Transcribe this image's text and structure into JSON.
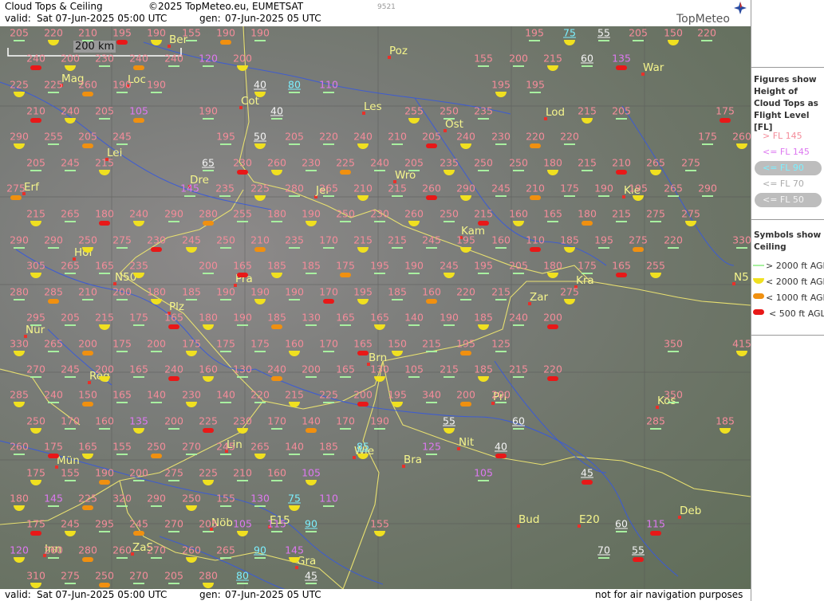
{
  "header": {
    "title": "Cloud Tops & Ceiling",
    "copyright": "©2025 TopMeteo.eu, EUMETSAT",
    "code": "9521",
    "valid_label": "valid:",
    "valid_time": "Sat  07-Jun-2025  05:00 UTC",
    "gen_label": "gen:",
    "gen_time": "07-Jun-2025 05 UTC",
    "brand": "TopMeteo"
  },
  "scale": {
    "label": "200 km"
  },
  "footer": {
    "valid_label": "valid:",
    "valid_time": "Sat  07-Jun-2025  05:00 UTC",
    "gen_label": "gen:",
    "gen_time": "07-Jun-2025 05 UTC",
    "disclaimer": "not for air navigation purposes"
  },
  "legend": {
    "figures_title": "Figures show Height of Cloud Tops as Flight Level  [FL]",
    "fl_items": [
      "> FL 145",
      "<= FL 145",
      "<= FL 90",
      "<= FL 70",
      "<= FL 50"
    ],
    "symbols_title": "Symbols show Ceiling",
    "ceiling_items": [
      "> 2000 ft AGL",
      "< 2000 ft AGL",
      "< 1000 ft AGL",
      "< 500 ft AGL"
    ],
    "colors": {
      "pink": "#f48c9a",
      "violet": "#dd78f0",
      "cyan": "#7cf0ff",
      "white": "#f4f4f4",
      "green": "#a8f0a0",
      "yellow": "#f0e020",
      "orange": "#f09010",
      "red": "#e81818"
    }
  },
  "cities": [
    {
      "name": "Ber"
    },
    {
      "name": "Poz"
    },
    {
      "name": "War"
    },
    {
      "name": "Mag"
    },
    {
      "name": "Loc"
    },
    {
      "name": "Cot"
    },
    {
      "name": "Les"
    },
    {
      "name": "Ost"
    },
    {
      "name": "Lod"
    },
    {
      "name": "Lei"
    },
    {
      "name": "Dre"
    },
    {
      "name": "Wro"
    },
    {
      "name": "Erf"
    },
    {
      "name": "Jel"
    },
    {
      "name": "Kie"
    },
    {
      "name": "Kam"
    },
    {
      "name": "Hof"
    },
    {
      "name": "N50"
    },
    {
      "name": "Pra"
    },
    {
      "name": "Kra"
    },
    {
      "name": "N5"
    },
    {
      "name": "Plz"
    },
    {
      "name": "Zar"
    },
    {
      "name": "Nür"
    },
    {
      "name": "Brn"
    },
    {
      "name": "Reg"
    },
    {
      "name": "Pri"
    },
    {
      "name": "Kos"
    },
    {
      "name": "Nit"
    },
    {
      "name": "Lin"
    },
    {
      "name": "Wie"
    },
    {
      "name": "Bra"
    },
    {
      "name": "Mün"
    },
    {
      "name": "Bud"
    },
    {
      "name": "E20"
    },
    {
      "name": "Deb"
    },
    {
      "name": "Nöb"
    },
    {
      "name": "E15"
    },
    {
      "name": "Inn"
    },
    {
      "name": "ZaS"
    },
    {
      "name": "Gra"
    }
  ],
  "values": [
    [
      "205",
      "p"
    ],
    [
      "220",
      "p"
    ],
    [
      "210",
      "p"
    ],
    [
      "195",
      "p"
    ],
    [
      "190",
      "p"
    ],
    [
      "155",
      "p"
    ],
    [
      "190",
      "p"
    ],
    [
      "190",
      "p"
    ],
    [
      "195",
      "p"
    ],
    [
      "75",
      "c"
    ],
    [
      "55",
      "w"
    ],
    [
      "205",
      "p"
    ],
    [
      "150",
      "p"
    ],
    [
      "220",
      "p"
    ],
    [
      "240",
      "p"
    ],
    [
      "200",
      "p"
    ],
    [
      "230",
      "p"
    ],
    [
      "240",
      "p"
    ],
    [
      "240",
      "p"
    ],
    [
      "120",
      "v"
    ],
    [
      "200",
      "p"
    ],
    [
      "155",
      "p"
    ],
    [
      "200",
      "p"
    ],
    [
      "215",
      "p"
    ],
    [
      "60",
      "w"
    ],
    [
      "135",
      "v"
    ],
    [
      "225",
      "p"
    ],
    [
      "225",
      "p"
    ],
    [
      "260",
      "p"
    ],
    [
      "190",
      "p"
    ],
    [
      "190",
      "p"
    ],
    [
      "40",
      "w"
    ],
    [
      "80",
      "c"
    ],
    [
      "110",
      "v"
    ],
    [
      "195",
      "p"
    ],
    [
      "195",
      "p"
    ],
    [
      "210",
      "p"
    ],
    [
      "240",
      "p"
    ],
    [
      "205",
      "p"
    ],
    [
      "105",
      "v"
    ],
    [
      "190",
      "p"
    ],
    [
      "40",
      "w"
    ],
    [
      "255",
      "p"
    ],
    [
      "250",
      "p"
    ],
    [
      "235",
      "p"
    ],
    [
      "215",
      "p"
    ],
    [
      "205",
      "p"
    ],
    [
      "175",
      "p"
    ],
    [
      "290",
      "p"
    ],
    [
      "255",
      "p"
    ],
    [
      "205",
      "p"
    ],
    [
      "245",
      "p"
    ],
    [
      "195",
      "p"
    ],
    [
      "50",
      "w"
    ],
    [
      "205",
      "p"
    ],
    [
      "220",
      "p"
    ],
    [
      "240",
      "p"
    ],
    [
      "210",
      "p"
    ],
    [
      "205",
      "p"
    ],
    [
      "240",
      "p"
    ],
    [
      "230",
      "p"
    ],
    [
      "220",
      "p"
    ],
    [
      "220",
      "p"
    ],
    [
      "175",
      "p"
    ],
    [
      "260",
      "p"
    ],
    [
      "205",
      "p"
    ],
    [
      "245",
      "p"
    ],
    [
      "215",
      "p"
    ],
    [
      "65",
      "w"
    ],
    [
      "230",
      "p"
    ],
    [
      "260",
      "p"
    ],
    [
      "230",
      "p"
    ],
    [
      "225",
      "p"
    ],
    [
      "240",
      "p"
    ],
    [
      "205",
      "p"
    ],
    [
      "235",
      "p"
    ],
    [
      "250",
      "p"
    ],
    [
      "250",
      "p"
    ],
    [
      "180",
      "p"
    ],
    [
      "215",
      "p"
    ],
    [
      "210",
      "p"
    ],
    [
      "265",
      "p"
    ],
    [
      "275",
      "p"
    ],
    [
      "275",
      "p"
    ],
    [
      "145",
      "v"
    ],
    [
      "235",
      "p"
    ],
    [
      "225",
      "p"
    ],
    [
      "280",
      "p"
    ],
    [
      "265",
      "p"
    ],
    [
      "210",
      "p"
    ],
    [
      "215",
      "p"
    ],
    [
      "260",
      "p"
    ],
    [
      "290",
      "p"
    ],
    [
      "245",
      "p"
    ],
    [
      "210",
      "p"
    ],
    [
      "175",
      "p"
    ],
    [
      "190",
      "p"
    ],
    [
      "195",
      "p"
    ],
    [
      "265",
      "p"
    ],
    [
      "290",
      "p"
    ],
    [
      "215",
      "p"
    ],
    [
      "265",
      "p"
    ],
    [
      "180",
      "p"
    ],
    [
      "240",
      "p"
    ],
    [
      "290",
      "p"
    ],
    [
      "280",
      "p"
    ],
    [
      "255",
      "p"
    ],
    [
      "180",
      "p"
    ],
    [
      "190",
      "p"
    ],
    [
      "250",
      "p"
    ],
    [
      "230",
      "p"
    ],
    [
      "260",
      "p"
    ],
    [
      "250",
      "p"
    ],
    [
      "215",
      "p"
    ],
    [
      "160",
      "p"
    ],
    [
      "165",
      "p"
    ],
    [
      "180",
      "p"
    ],
    [
      "215",
      "p"
    ],
    [
      "275",
      "p"
    ],
    [
      "275",
      "p"
    ],
    [
      "290",
      "p"
    ],
    [
      "290",
      "p"
    ],
    [
      "250",
      "p"
    ],
    [
      "275",
      "p"
    ],
    [
      "230",
      "p"
    ],
    [
      "245",
      "p"
    ],
    [
      "250",
      "p"
    ],
    [
      "210",
      "p"
    ],
    [
      "235",
      "p"
    ],
    [
      "170",
      "p"
    ],
    [
      "215",
      "p"
    ],
    [
      "215",
      "p"
    ],
    [
      "245",
      "p"
    ],
    [
      "195",
      "p"
    ],
    [
      "160",
      "p"
    ],
    [
      "110",
      "p"
    ],
    [
      "185",
      "p"
    ],
    [
      "195",
      "p"
    ],
    [
      "275",
      "p"
    ],
    [
      "220",
      "p"
    ],
    [
      "330",
      "p"
    ],
    [
      "305",
      "p"
    ],
    [
      "265",
      "p"
    ],
    [
      "165",
      "p"
    ],
    [
      "235",
      "p"
    ],
    [
      "200",
      "p"
    ],
    [
      "165",
      "p"
    ],
    [
      "185",
      "p"
    ],
    [
      "185",
      "p"
    ],
    [
      "175",
      "p"
    ],
    [
      "195",
      "p"
    ],
    [
      "190",
      "p"
    ],
    [
      "245",
      "p"
    ],
    [
      "195",
      "p"
    ],
    [
      "205",
      "p"
    ],
    [
      "180",
      "p"
    ],
    [
      "175",
      "p"
    ],
    [
      "165",
      "p"
    ],
    [
      "255",
      "p"
    ],
    [
      "280",
      "p"
    ],
    [
      "285",
      "p"
    ],
    [
      "210",
      "p"
    ],
    [
      "200",
      "p"
    ],
    [
      "180",
      "p"
    ],
    [
      "185",
      "p"
    ],
    [
      "190",
      "p"
    ],
    [
      "190",
      "p"
    ],
    [
      "190",
      "p"
    ],
    [
      "170",
      "p"
    ],
    [
      "195",
      "p"
    ],
    [
      "185",
      "p"
    ],
    [
      "160",
      "p"
    ],
    [
      "220",
      "p"
    ],
    [
      "215",
      "p"
    ],
    [
      "275",
      "p"
    ],
    [
      "295",
      "p"
    ],
    [
      "205",
      "p"
    ],
    [
      "215",
      "p"
    ],
    [
      "175",
      "p"
    ],
    [
      "165",
      "p"
    ],
    [
      "180",
      "p"
    ],
    [
      "190",
      "p"
    ],
    [
      "185",
      "p"
    ],
    [
      "130",
      "p"
    ],
    [
      "165",
      "p"
    ],
    [
      "165",
      "p"
    ],
    [
      "140",
      "p"
    ],
    [
      "190",
      "p"
    ],
    [
      "185",
      "p"
    ],
    [
      "240",
      "p"
    ],
    [
      "200",
      "p"
    ],
    [
      "330",
      "p"
    ],
    [
      "265",
      "p"
    ],
    [
      "200",
      "p"
    ],
    [
      "175",
      "p"
    ],
    [
      "200",
      "p"
    ],
    [
      "175",
      "p"
    ],
    [
      "175",
      "p"
    ],
    [
      "175",
      "p"
    ],
    [
      "160",
      "p"
    ],
    [
      "170",
      "p"
    ],
    [
      "165",
      "p"
    ],
    [
      "150",
      "p"
    ],
    [
      "215",
      "p"
    ],
    [
      "195",
      "p"
    ],
    [
      "125",
      "p"
    ],
    [
      "350",
      "p"
    ],
    [
      "415",
      "p"
    ],
    [
      "270",
      "p"
    ],
    [
      "245",
      "p"
    ],
    [
      "200",
      "p"
    ],
    [
      "165",
      "p"
    ],
    [
      "240",
      "p"
    ],
    [
      "160",
      "p"
    ],
    [
      "130",
      "p"
    ],
    [
      "240",
      "p"
    ],
    [
      "200",
      "p"
    ],
    [
      "165",
      "p"
    ],
    [
      "130",
      "p"
    ],
    [
      "105",
      "p"
    ],
    [
      "215",
      "p"
    ],
    [
      "185",
      "p"
    ],
    [
      "215",
      "p"
    ],
    [
      "220",
      "p"
    ],
    [
      "285",
      "p"
    ],
    [
      "240",
      "p"
    ],
    [
      "150",
      "p"
    ],
    [
      "165",
      "p"
    ],
    [
      "140",
      "p"
    ],
    [
      "230",
      "p"
    ],
    [
      "140",
      "p"
    ],
    [
      "220",
      "p"
    ],
    [
      "215",
      "p"
    ],
    [
      "225",
      "p"
    ],
    [
      "200",
      "p"
    ],
    [
      "195",
      "p"
    ],
    [
      "340",
      "p"
    ],
    [
      "200",
      "p"
    ],
    [
      "200",
      "p"
    ],
    [
      "350",
      "p"
    ],
    [
      "250",
      "p"
    ],
    [
      "170",
      "p"
    ],
    [
      "160",
      "p"
    ],
    [
      "135",
      "v"
    ],
    [
      "200",
      "p"
    ],
    [
      "225",
      "p"
    ],
    [
      "230",
      "p"
    ],
    [
      "170",
      "p"
    ],
    [
      "140",
      "p"
    ],
    [
      "170",
      "p"
    ],
    [
      "190",
      "p"
    ],
    [
      "55",
      "w"
    ],
    [
      "60",
      "w"
    ],
    [
      "285",
      "p"
    ],
    [
      "185",
      "p"
    ],
    [
      "260",
      "p"
    ],
    [
      "175",
      "p"
    ],
    [
      "165",
      "p"
    ],
    [
      "155",
      "p"
    ],
    [
      "250",
      "p"
    ],
    [
      "270",
      "p"
    ],
    [
      "245",
      "p"
    ],
    [
      "265",
      "p"
    ],
    [
      "140",
      "p"
    ],
    [
      "185",
      "p"
    ],
    [
      "85",
      "c"
    ],
    [
      "125",
      "v"
    ],
    [
      "40",
      "w"
    ],
    [
      "175",
      "p"
    ],
    [
      "155",
      "p"
    ],
    [
      "190",
      "p"
    ],
    [
      "200",
      "p"
    ],
    [
      "275",
      "p"
    ],
    [
      "225",
      "p"
    ],
    [
      "210",
      "p"
    ],
    [
      "160",
      "p"
    ],
    [
      "105",
      "v"
    ],
    [
      "105",
      "v"
    ],
    [
      "45",
      "w"
    ],
    [
      "180",
      "p"
    ],
    [
      "145",
      "v"
    ],
    [
      "225",
      "p"
    ],
    [
      "320",
      "p"
    ],
    [
      "290",
      "p"
    ],
    [
      "250",
      "p"
    ],
    [
      "155",
      "p"
    ],
    [
      "130",
      "v"
    ],
    [
      "75",
      "c"
    ],
    [
      "110",
      "v"
    ],
    [
      "175",
      "p"
    ],
    [
      "245",
      "p"
    ],
    [
      "295",
      "p"
    ],
    [
      "245",
      "p"
    ],
    [
      "270",
      "p"
    ],
    [
      "205",
      "p"
    ],
    [
      "105",
      "v"
    ],
    [
      "115",
      "v"
    ],
    [
      "90",
      "c"
    ],
    [
      "155",
      "p"
    ],
    [
      "60",
      "w"
    ],
    [
      "115",
      "v"
    ],
    [
      "120",
      "v"
    ],
    [
      "260",
      "p"
    ],
    [
      "280",
      "p"
    ],
    [
      "260",
      "p"
    ],
    [
      "270",
      "p"
    ],
    [
      "260",
      "p"
    ],
    [
      "265",
      "p"
    ],
    [
      "90",
      "c"
    ],
    [
      "145",
      "v"
    ],
    [
      "70",
      "w"
    ],
    [
      "55",
      "w"
    ],
    [
      "310",
      "p"
    ],
    [
      "275",
      "p"
    ],
    [
      "250",
      "p"
    ],
    [
      "270",
      "p"
    ],
    [
      "205",
      "p"
    ],
    [
      "280",
      "p"
    ],
    [
      "80",
      "c"
    ],
    [
      "45",
      "w"
    ]
  ]
}
